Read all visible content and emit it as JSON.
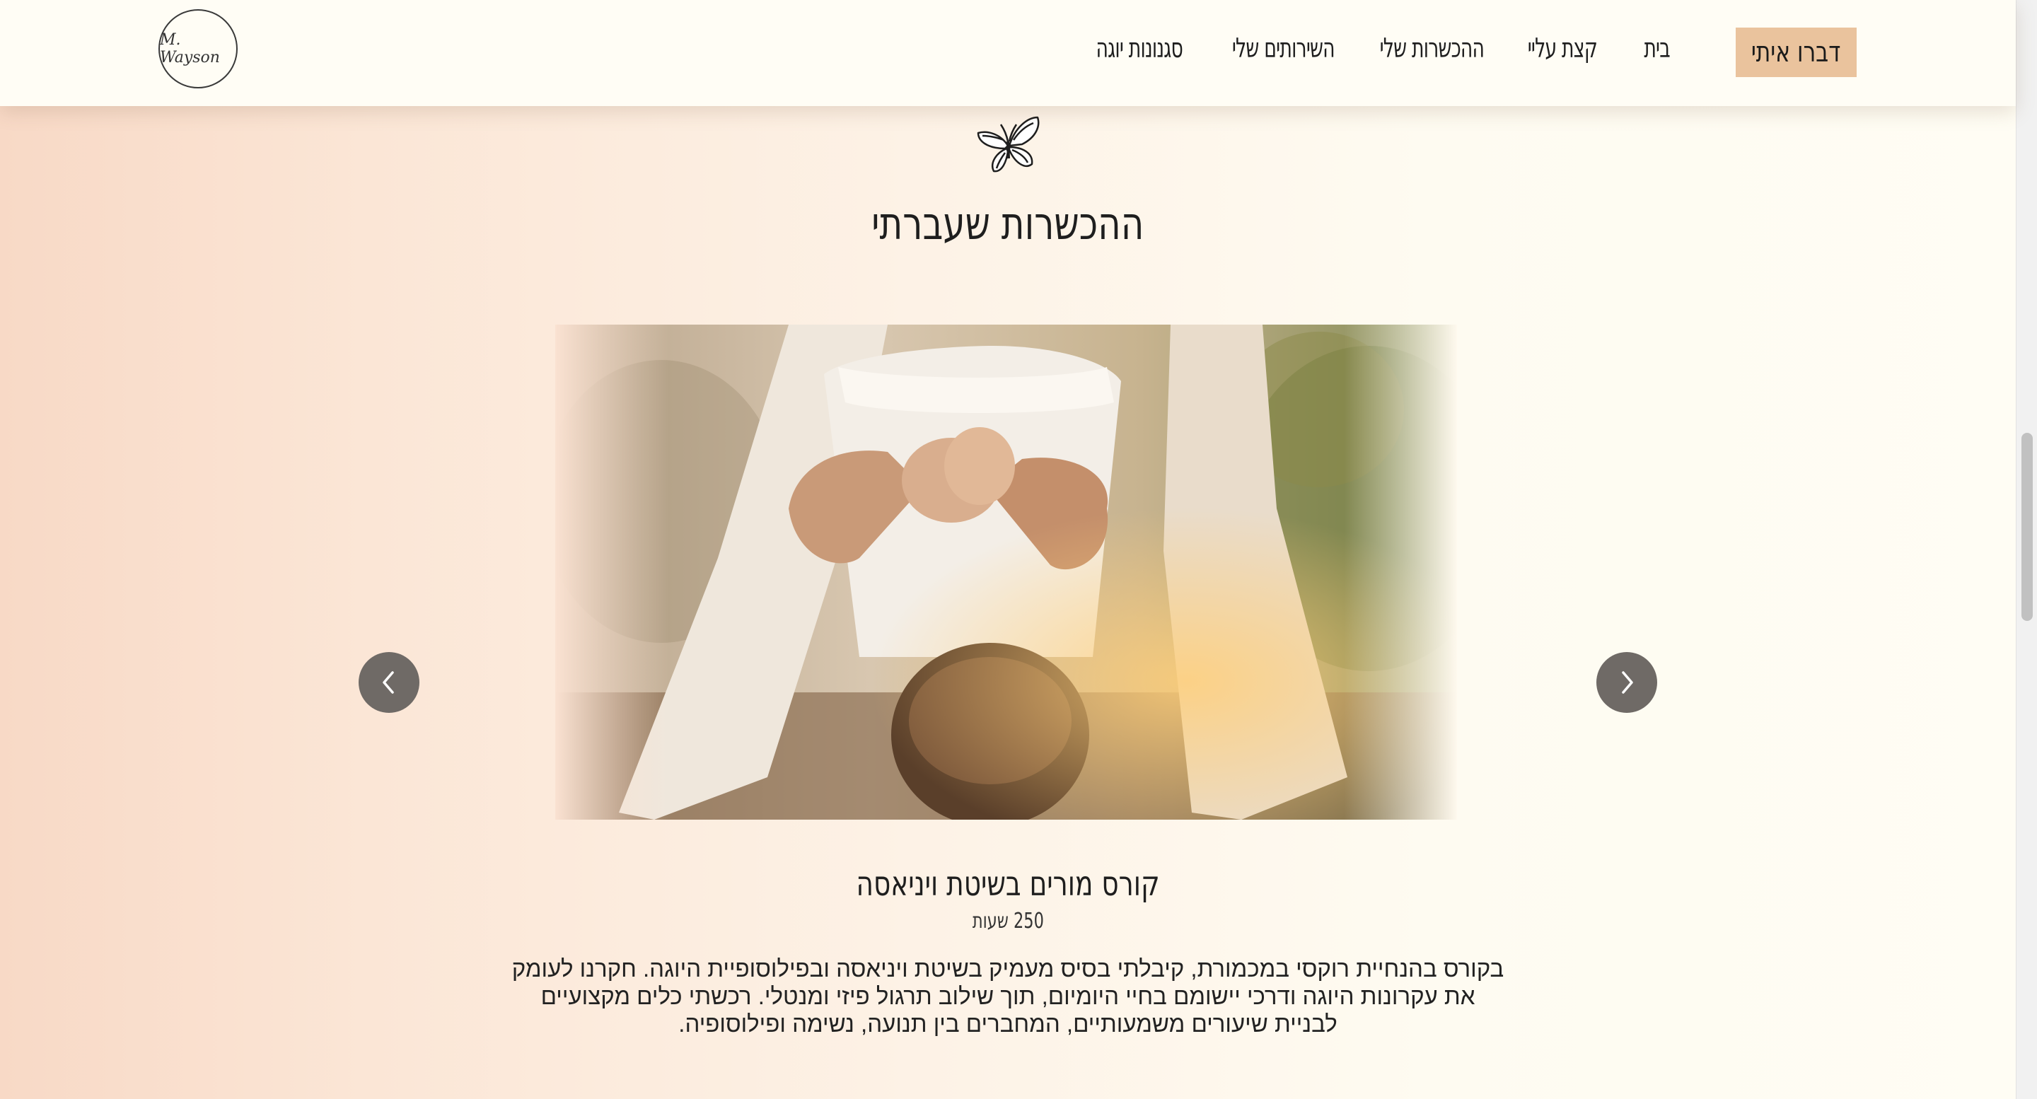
{
  "header": {
    "logo_text": "M. Wayson",
    "nav": [
      {
        "label": "בית"
      },
      {
        "label": "קצת עליי"
      },
      {
        "label": "ההכשרות שלי"
      },
      {
        "label": "השירותים שלי"
      },
      {
        "label": "סגנונות יוגה"
      }
    ],
    "cta_label": "דברו איתי"
  },
  "section": {
    "icon": "butterfly-icon",
    "title": "ההכשרות שעברתי"
  },
  "carousel": {
    "prev_icon": "chevron-left-icon",
    "next_icon": "chevron-right-icon",
    "slide": {
      "image": "yoga-pose-photo",
      "title": "קורס מורים בשיטת ויניאסה",
      "hours": "250 שעות",
      "description": "בקורס בהנחיית רוקסי במכמורת, קיבלתי בסיס מעמיק בשיטת ויניאסה ובפילוסופיית היוגה. חקרנו לעומק את עקרונות היוגה ודרכי יישומם בחיי היומיום, תוך שילוב תרגול פיזי ומנטלי. רכשתי כלים מקצועיים לבניית שיעורים משמעותיים, המחברים בין תנועה, נשימה ופילוסופיה."
    }
  },
  "colors": {
    "header_bg": "#fffdf5",
    "cta_bg": "#eac39d",
    "arrow_bg": "#6f6a66",
    "bg_left": "#f8d9c6",
    "bg_right": "#fffdf4"
  }
}
